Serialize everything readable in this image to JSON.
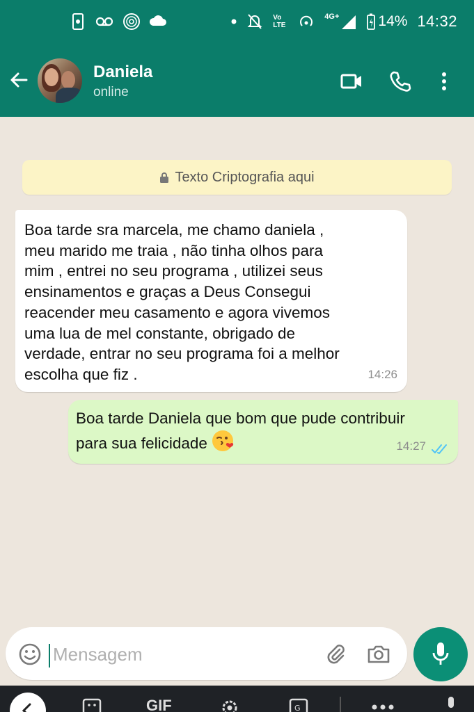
{
  "status_bar": {
    "left_icons": [
      "screen-recorder-icon",
      "voicemail-icon",
      "fingerprint-icon",
      "cloud-icon"
    ],
    "right_icons": [
      "dot-icon",
      "muted-bell-icon",
      "volte-icon",
      "hotspot-icon",
      "signal-4g-icon",
      "battery-icon"
    ],
    "volte": "Vo LTE",
    "network": "4G+",
    "battery": "14%",
    "time": "14:32"
  },
  "header": {
    "contact_name": "Daniela",
    "contact_status": "online",
    "icons": [
      "back-arrow-icon",
      "video-call-icon",
      "phone-icon",
      "more-vert-icon"
    ]
  },
  "chat": {
    "encryption_notice": "Texto Criptografia aqui",
    "messages": [
      {
        "direction": "incoming",
        "text": "Boa tarde sra marcela, me chamo daniela ,\nmeu marido me traia , não tinha olhos para\nmim , entrei no seu programa , utilizei seus\nensinamentos e graças a Deus Consegui\nreacender meu casamento e agora vivemos\numa lua de mel constante, obrigado de\nverdade, entrar no seu programa  foi a melhor\nescolha que fiz .",
        "time": "14:26"
      },
      {
        "direction": "outgoing",
        "text": "Boa tarde Daniela que bom que pude contribuir\npara sua felicidade",
        "emoji": "kissing-face-heart-emoji",
        "time": "14:27",
        "status": "read"
      }
    ]
  },
  "composer": {
    "placeholder": "Mensagem",
    "icons": [
      "emoji-icon",
      "attach-icon",
      "camera-icon",
      "mic-icon"
    ]
  },
  "keyboard_bar": {
    "gif_label": "GIF"
  },
  "colors": {
    "header": "#0B7D6A",
    "outgoing_bubble": "#DCF8C6",
    "incoming_bubble": "#FFFFFF",
    "banner": "#FCF4C6",
    "mic_button": "#0B8F76",
    "read_ticks": "#4FC3F7"
  }
}
